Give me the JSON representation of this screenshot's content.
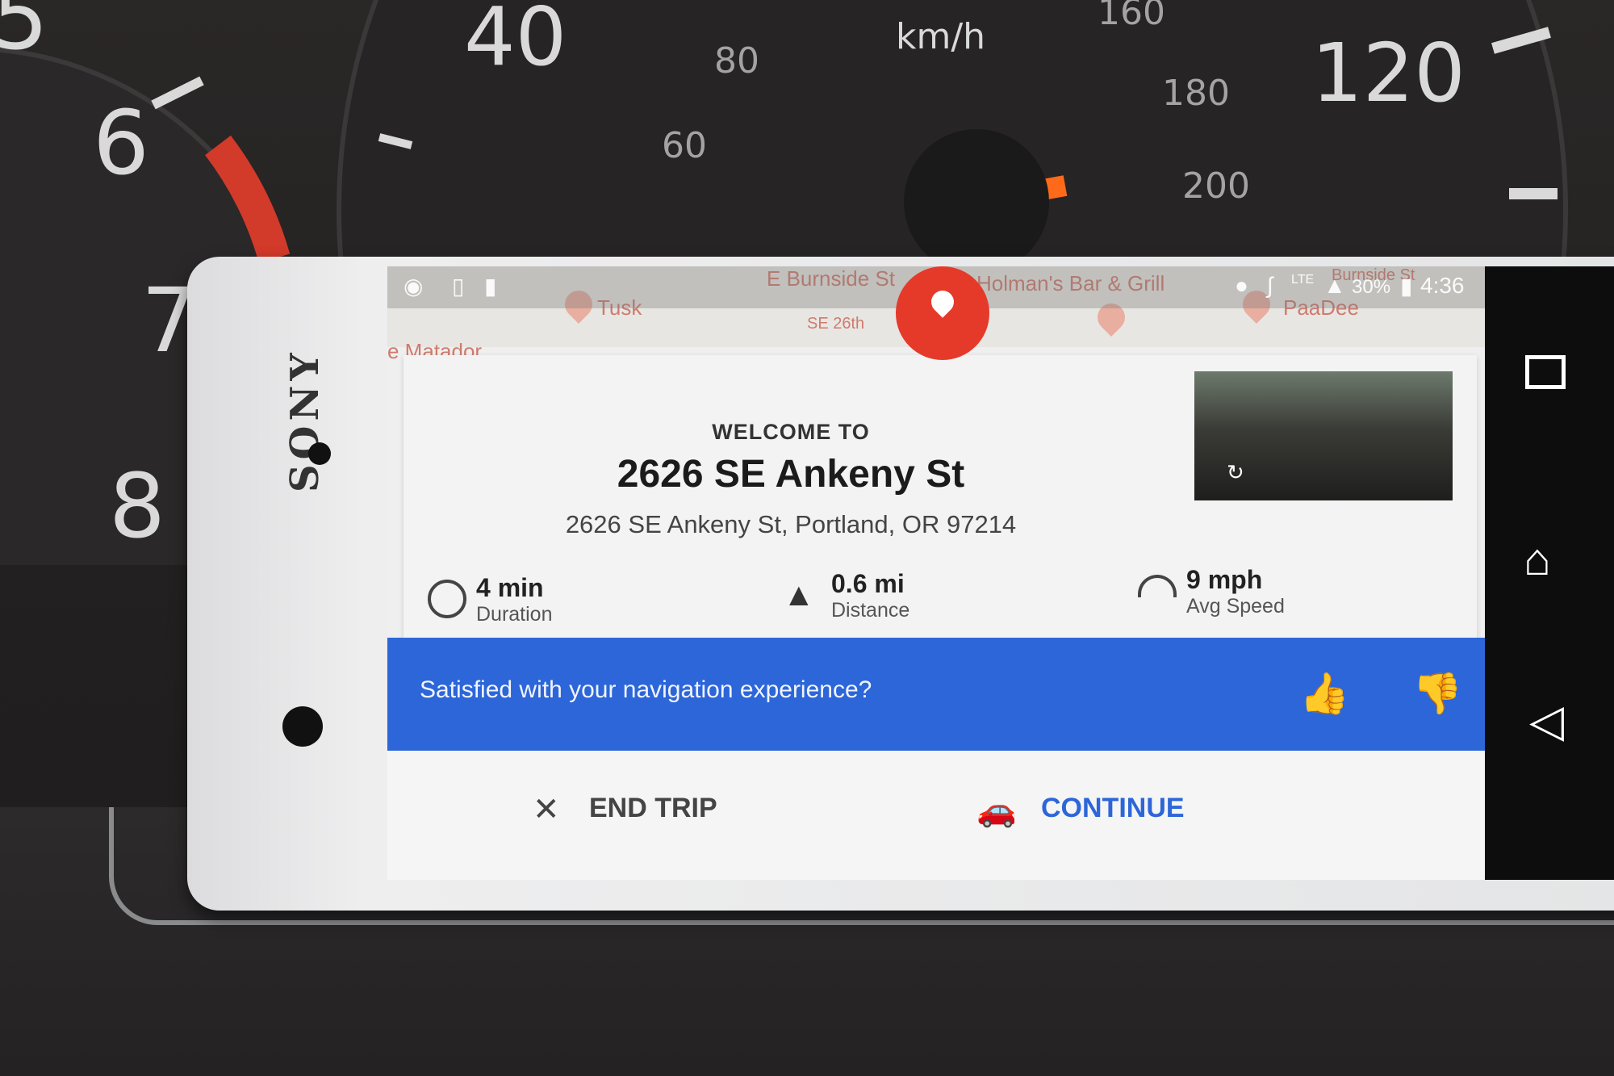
{
  "status_bar": {
    "battery": "30%",
    "time": "4:36",
    "network": "LTE"
  },
  "map": {
    "streets": [
      "E Burnside St",
      "SE 26th",
      "Burnside St"
    ],
    "places": [
      "Holman's Bar & Grill",
      "Tusk",
      "PaaDee",
      "e Matador"
    ]
  },
  "arrival_card": {
    "welcome": "WELCOME TO",
    "place_name": "2626 SE Ankeny St",
    "address": "2626 SE Ankeny St, Portland, OR 97214",
    "stats": [
      {
        "value": "4 min",
        "label": "Duration",
        "icon": "clock-icon"
      },
      {
        "value": "0.6 mi",
        "label": "Distance",
        "icon": "road-icon"
      },
      {
        "value": "9 mph",
        "label": "Avg Speed",
        "icon": "speedometer-icon"
      }
    ]
  },
  "feedback_banner": {
    "text": "Satisfied with your navigation experience?"
  },
  "actions": {
    "end_trip": "END TRIP",
    "continue": "CONTINUE"
  },
  "device": {
    "brand": "SONY"
  },
  "dashboard": {
    "tach_numbers": [
      "5",
      "6",
      "7",
      "8"
    ],
    "speed_numbers": [
      "40",
      "120",
      "80",
      "60",
      "180",
      "200",
      "160"
    ],
    "speed_unit": "km/h"
  },
  "colors": {
    "banner": "#2c66d8",
    "pin": "#e53a2a",
    "continue_text": "#2c66d8"
  }
}
